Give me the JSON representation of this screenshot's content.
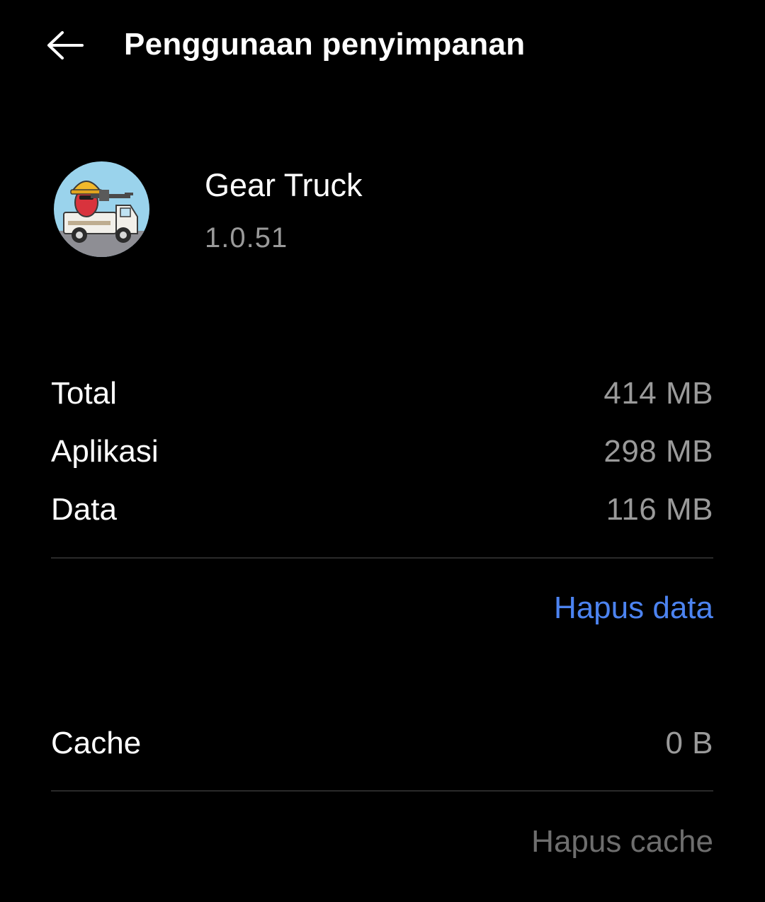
{
  "header": {
    "back_icon": "arrow-left-icon",
    "title": "Penggunaan penyimpanan"
  },
  "app": {
    "icon": "gear-truck-app-icon",
    "name": "Gear Truck",
    "version": "1.0.51"
  },
  "storage": {
    "rows": [
      {
        "label": "Total",
        "value": "414 MB"
      },
      {
        "label": "Aplikasi",
        "value": "298 MB"
      },
      {
        "label": "Data",
        "value": "116 MB"
      }
    ],
    "clear_data_label": "Hapus data"
  },
  "cache": {
    "label": "Cache",
    "value": "0 B",
    "clear_cache_label": "Hapus cache"
  },
  "colors": {
    "background": "#000000",
    "primary_text": "#ffffff",
    "secondary_text": "#9a9a9a",
    "accent": "#4c83f0",
    "disabled": "#6e6e6e",
    "divider": "#2a2a2a"
  }
}
